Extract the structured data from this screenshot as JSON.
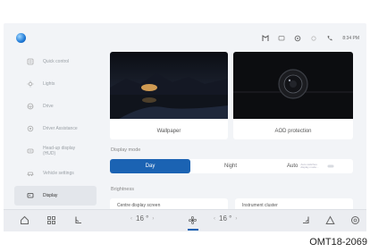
{
  "status_bar": {
    "icons": [
      "navigation-icon",
      "chat-icon",
      "settings-cog-icon",
      "location-icon",
      "phone-icon"
    ],
    "time": "8:34 PM"
  },
  "sidebar": {
    "items": [
      {
        "label": "Quick control",
        "icon": "quick-control-icon"
      },
      {
        "label": "Lights",
        "icon": "lights-icon"
      },
      {
        "label": "Drive",
        "icon": "drive-icon"
      },
      {
        "label": "Driver Assistance",
        "icon": "driver-assistance-icon"
      },
      {
        "label": "Head-up display (HUD)",
        "icon": "hud-icon"
      },
      {
        "label": "Vehicle settings",
        "icon": "vehicle-icon"
      },
      {
        "label": "Display",
        "icon": "display-icon",
        "active": true
      }
    ]
  },
  "cards": {
    "wallpaper": "Wallpaper",
    "aod": "AOD protection"
  },
  "display_mode": {
    "label": "Display mode",
    "options": [
      "Day",
      "Night",
      "Auto"
    ],
    "selected": "Day",
    "auto_note": "Auto switches display mode..."
  },
  "brightness": {
    "label": "Brightness",
    "centre": "Centre display screen",
    "cluster": "Instrument cluster"
  },
  "bottom_bar": {
    "left_temp": "16 °",
    "right_temp": "16 °",
    "left_arrow_l": "‹",
    "left_arrow_r": "›",
    "right_arrow_l": "‹",
    "right_arrow_r": "›"
  },
  "caption": "OMT18-2069",
  "colors": {
    "accent": "#1b63b3",
    "screen_bg": "#f2f4f7"
  }
}
